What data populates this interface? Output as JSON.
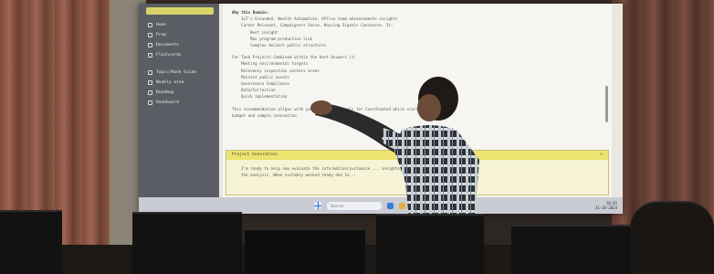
{
  "sidebar": {
    "items": [
      {
        "label": "Home",
        "icon": "home-icon"
      },
      {
        "label": "Prep",
        "icon": "prep-icon"
      },
      {
        "label": "Documents",
        "icon": "documents-icon"
      },
      {
        "label": "Flashcards",
        "icon": "flashcards-icon"
      },
      {
        "label": "Topic/Rank Guide",
        "icon": "guide-icon"
      },
      {
        "label": "Weakly area",
        "icon": "area-icon"
      },
      {
        "label": "Roadmap",
        "icon": "roadmap-icon"
      },
      {
        "label": "Dashboard",
        "icon": "dashboard-icon"
      }
    ]
  },
  "content": {
    "heading": "Why this Domain:",
    "bullets": [
      "IoT's Grounded, Wealth Automation, Office team advancements insights",
      "Career Relevant, Campaigners Sense, Housing Signals Concourse. It:"
    ],
    "sub_bullets": [
      "Best insight",
      "Max program productive link",
      "Complex delimit public structures"
    ],
    "intro": "For Task Projects Combined within the best Answers it:",
    "list": [
      "Meeting environmental targets",
      "Relevancy inspection sectors areas",
      "Mainset public assets",
      "Governance Compliance",
      "Data/Collection",
      "Quick implementation"
    ],
    "footer_line": "This recommendation aligns with your current... goals for Coordinated while scoring online",
    "footer_line2": "budget and sample innovation"
  },
  "callout": {
    "title": "Project Generation",
    "body_line1": "I'm ready to help now evaluate the information/customize ... insights about",
    "body_line2": "the analysis. When suitably worked ready due to..."
  },
  "taskbar": {
    "search_placeholder": "Search",
    "time": "10:45",
    "date": "31-10-2024"
  },
  "colors": {
    "sidebar_bg": "#5a5d63",
    "accent_yellow": "#ece46e",
    "taskbar_bg": "#c9ccd2"
  }
}
